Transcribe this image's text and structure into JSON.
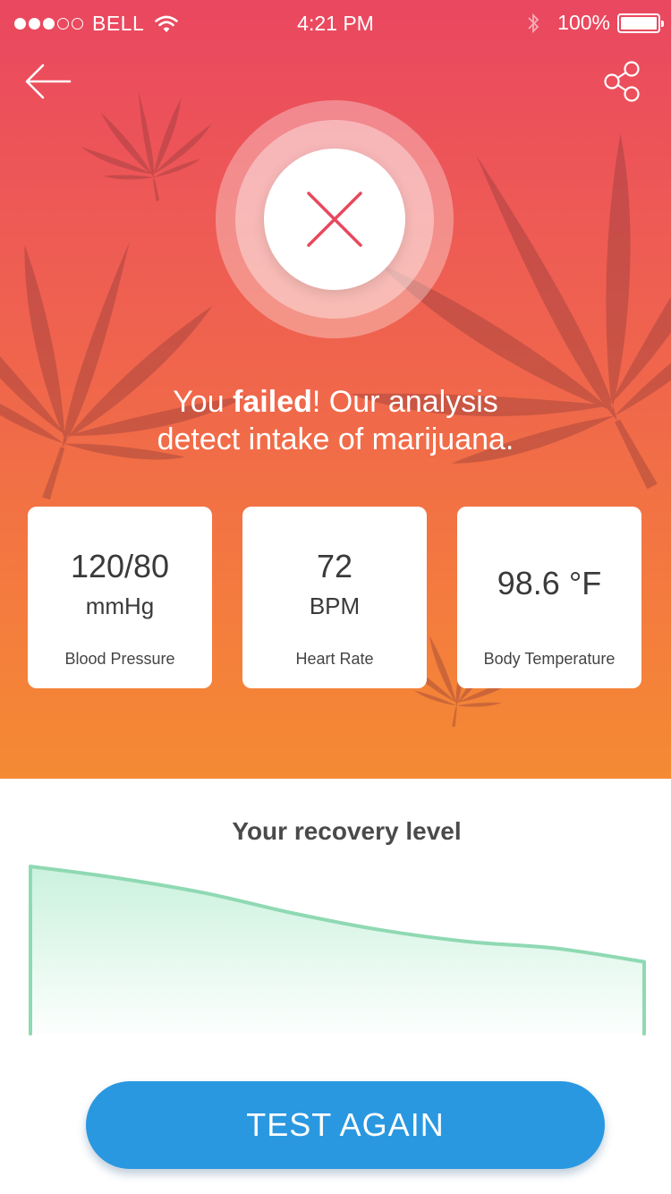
{
  "status_bar": {
    "carrier": "BELL",
    "time": "4:21 PM",
    "battery": "100%",
    "signal_strength": 3,
    "signal_max": 5
  },
  "icons": {
    "back": "arrow-left-icon",
    "share": "share-icon",
    "result": "close-icon"
  },
  "result": {
    "line1_pre": "You ",
    "line1_bold": "failed",
    "line1_post": "! Our analysis",
    "line2": "detect intake of marijuana."
  },
  "metrics": [
    {
      "value": "120/80",
      "unit": "mmHg",
      "label": "Blood Pressure"
    },
    {
      "value": "72",
      "unit": "BPM",
      "label": "Heart Rate"
    },
    {
      "value": "98.6 °F",
      "unit": "",
      "label": "Body Temperature"
    }
  ],
  "recovery": {
    "title": "Your recovery level",
    "chart_data": {
      "type": "area",
      "x": [
        0,
        1,
        2,
        3,
        4,
        5,
        6,
        7
      ],
      "y": [
        1.0,
        0.93,
        0.84,
        0.72,
        0.62,
        0.55,
        0.51,
        0.43
      ],
      "ylim": [
        0,
        1
      ],
      "color": "#8fd9b3",
      "fill_color": "#c8f1dc"
    }
  },
  "actions": {
    "test_again_label": "TEST AGAIN"
  },
  "colors": {
    "hero_top": "#ea4760",
    "hero_bottom": "#f48a33",
    "fail_red": "#e8485c",
    "button_blue": "#2a98e0"
  }
}
